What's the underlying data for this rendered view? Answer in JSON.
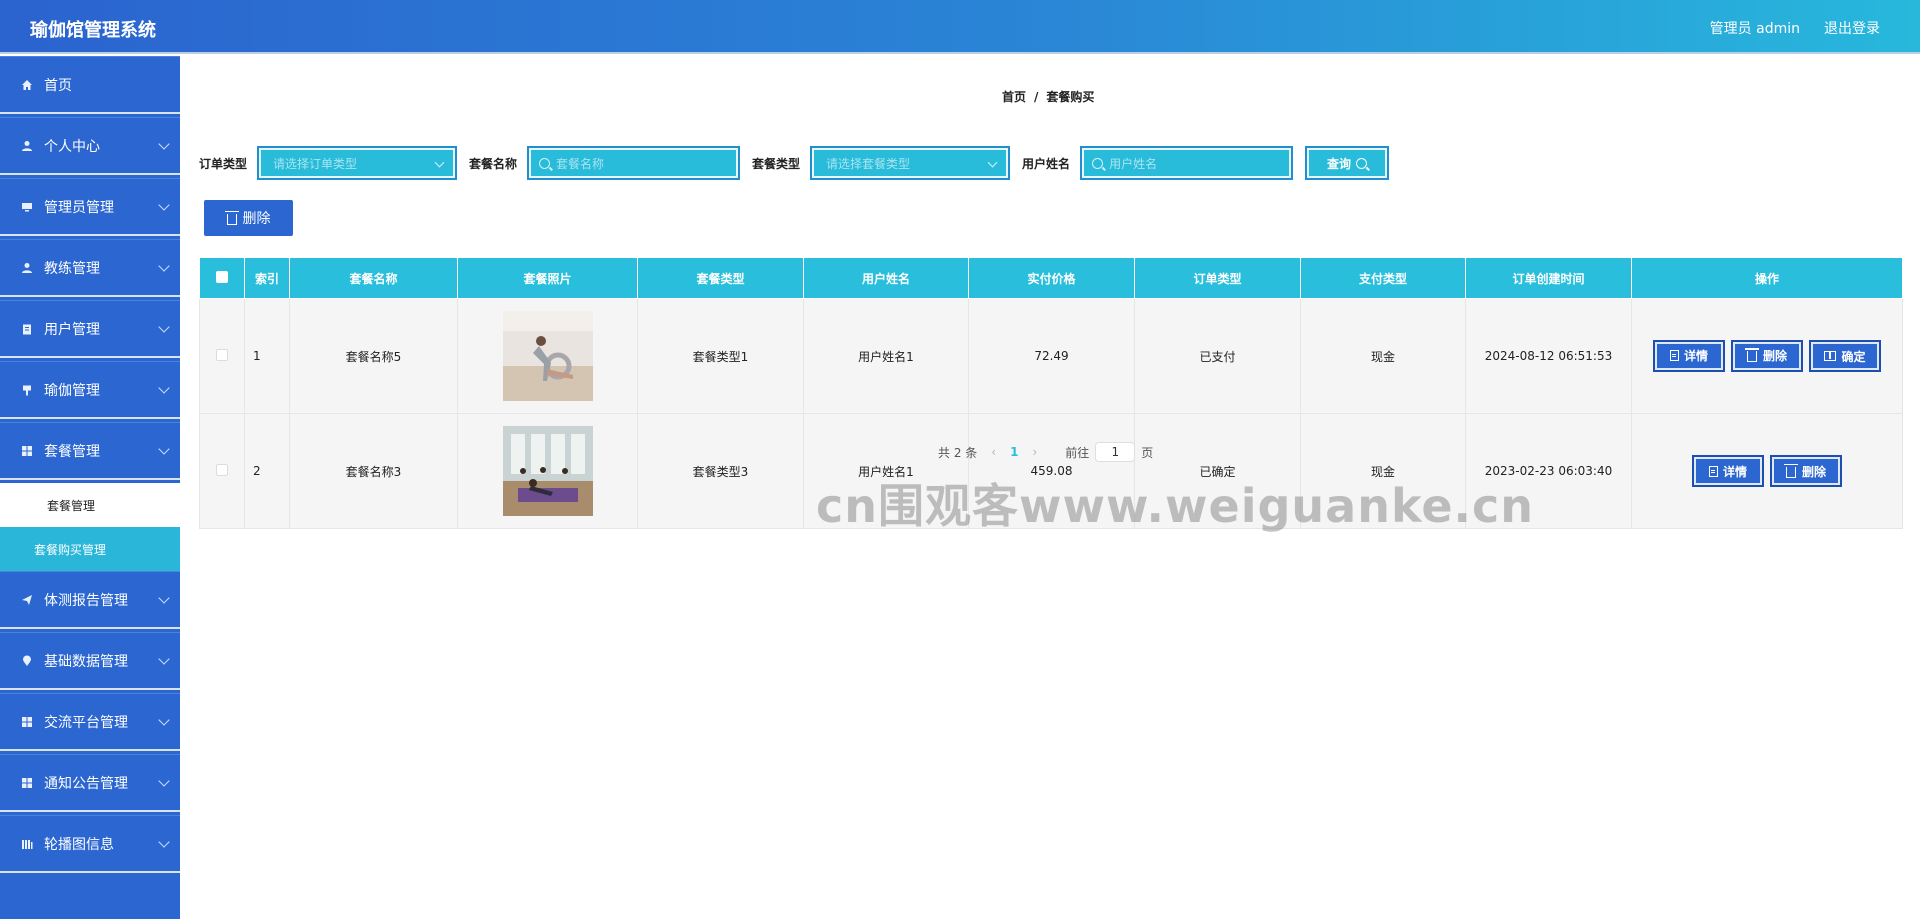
{
  "app": {
    "title": "瑜伽馆管理系统",
    "admin_text": "管理员 admin",
    "logout": "退出登录"
  },
  "sidebar": {
    "items": [
      {
        "label": "首页",
        "icon": "home-icon",
        "has_arrow": false
      },
      {
        "label": "个人中心",
        "icon": "user-icon",
        "has_arrow": true
      },
      {
        "label": "管理员管理",
        "icon": "monitor-icon",
        "has_arrow": true
      },
      {
        "label": "教练管理",
        "icon": "user-icon",
        "has_arrow": true
      },
      {
        "label": "用户管理",
        "icon": "clipboard-icon",
        "has_arrow": true
      },
      {
        "label": "瑜伽管理",
        "icon": "flag-icon",
        "has_arrow": true
      },
      {
        "label": "套餐管理",
        "icon": "grid-icon",
        "has_arrow": true
      }
    ],
    "sub_items": [
      {
        "label": "套餐管理",
        "active": false
      },
      {
        "label": "套餐购买管理",
        "active": true
      }
    ],
    "items_after": [
      {
        "label": "体测报告管理",
        "icon": "send-icon",
        "has_arrow": true
      },
      {
        "label": "基础数据管理",
        "icon": "location-icon",
        "has_arrow": true
      },
      {
        "label": "交流平台管理",
        "icon": "grid-icon",
        "has_arrow": true
      },
      {
        "label": "通知公告管理",
        "icon": "grid-icon",
        "has_arrow": true
      },
      {
        "label": "轮播图信息",
        "icon": "bar-icon",
        "has_arrow": true
      }
    ]
  },
  "breadcrumb": {
    "home": "首页",
    "separator": "/",
    "current": "套餐购买"
  },
  "filters": {
    "order_type_label": "订单类型",
    "order_type_placeholder": "请选择订单类型",
    "package_name_label": "套餐名称",
    "package_name_placeholder": "套餐名称",
    "package_type_label": "套餐类型",
    "package_type_placeholder": "请选择套餐类型",
    "user_name_label": "用户姓名",
    "user_name_placeholder": "用户姓名",
    "query_button": "查询"
  },
  "toolbar": {
    "delete_label": "删除"
  },
  "table": {
    "headers": [
      "",
      "索引",
      "套餐名称",
      "套餐照片",
      "套餐类型",
      "用户姓名",
      "实付价格",
      "订单类型",
      "支付类型",
      "订单创建时间",
      "操作"
    ],
    "rows": [
      {
        "index": "1",
        "name": "套餐名称5",
        "photo": "yoga-wheel-photo",
        "type": "套餐类型1",
        "user": "用户姓名1",
        "price": "72.49",
        "order_type": "已支付",
        "pay_type": "现金",
        "created": "2024-08-12 06:51:53",
        "actions": [
          "详情",
          "删除",
          "确定"
        ]
      },
      {
        "index": "2",
        "name": "套餐名称3",
        "photo": "yoga-class-photo",
        "type": "套餐类型3",
        "user": "用户姓名1",
        "price": "459.08",
        "order_type": "已确定",
        "pay_type": "现金",
        "created": "2023-02-23 06:03:40",
        "actions": [
          "详情",
          "删除"
        ]
      }
    ]
  },
  "pager": {
    "total": "共 2 条",
    "current_page": "1",
    "goto_label": "前往",
    "goto_value": "1",
    "page_suffix": "页"
  },
  "watermark": "cn围观客www.weiguanke.cn",
  "colors": {
    "primary": "#2b66d1",
    "accent": "#29bfdc"
  }
}
